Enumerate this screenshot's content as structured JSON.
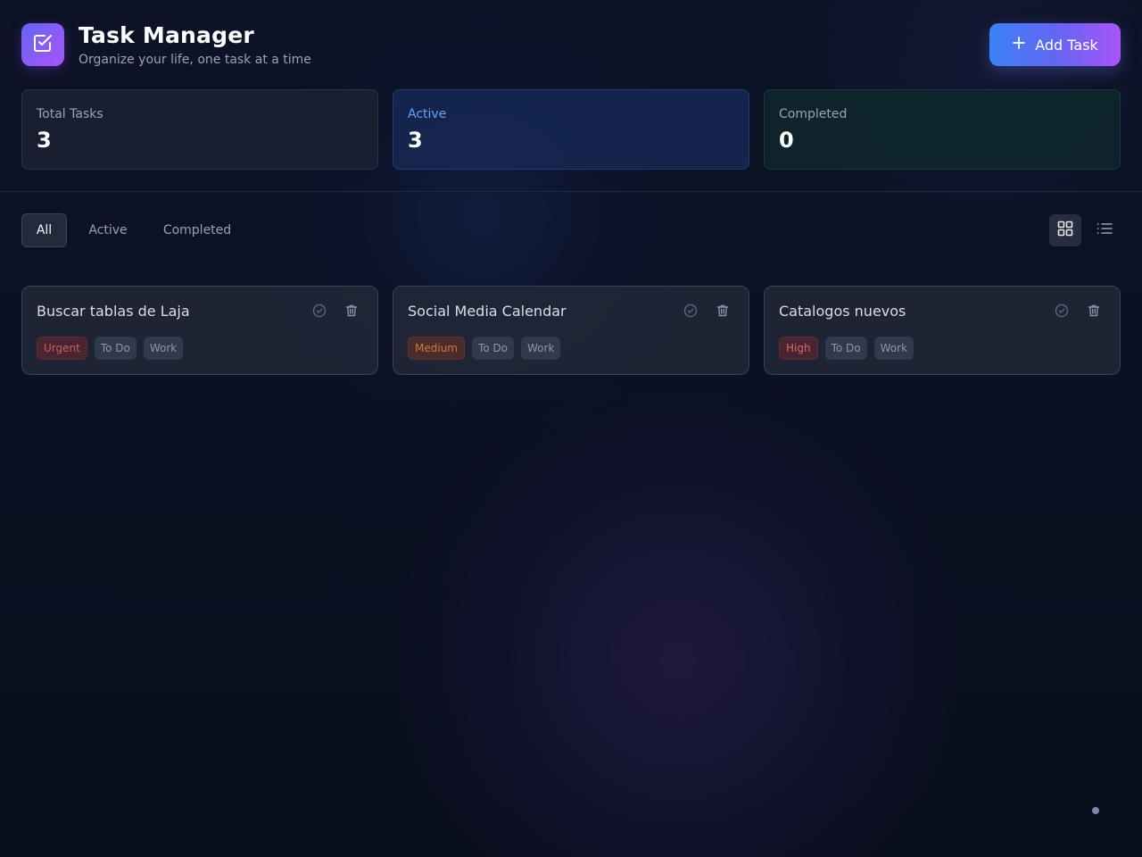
{
  "header": {
    "title": "Task Manager",
    "subtitle": "Organize your life, one task at a time",
    "add_label": "Add Task",
    "logo_icon": "check-square-icon"
  },
  "stats": {
    "total": {
      "label": "Total Tasks",
      "value": "3"
    },
    "active": {
      "label": "Active",
      "value": "3"
    },
    "completed": {
      "label": "Completed",
      "value": "0"
    }
  },
  "filters": [
    "All",
    "Active",
    "Completed"
  ],
  "selected_filter": "All",
  "view_modes": [
    "grid-icon",
    "list-icon"
  ],
  "selected_view": "grid",
  "tasks": [
    {
      "title": "Buscar tablas de Laja",
      "priority": "Urgent",
      "status": "To Do",
      "category": "Work"
    },
    {
      "title": "Social Media Calendar",
      "priority": "Medium",
      "status": "To Do",
      "category": "Work"
    },
    {
      "title": "Catalogos nuevos",
      "priority": "High",
      "status": "To Do",
      "category": "Work"
    }
  ],
  "colors": {
    "accent_start": "#3b82f6",
    "accent_end": "#a855f7",
    "urgent_bg": "#4a2430",
    "urgent_fg": "#c5615b",
    "medium_bg": "#4a2c2c",
    "medium_fg": "#d3773e",
    "high_bg": "#4a2430",
    "high_fg": "#d16b66",
    "active_label": "#60a5fa"
  }
}
